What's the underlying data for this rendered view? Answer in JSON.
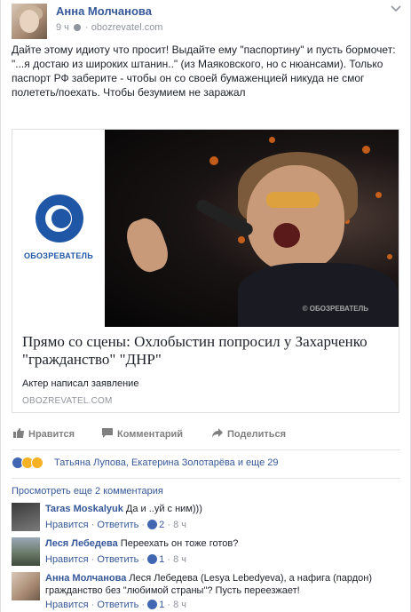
{
  "post": {
    "author": "Анна Молчанова",
    "time": "9 ч",
    "separator": "·",
    "source": "obozrevatel.com",
    "text": "Дайте этому идиоту что просит! Выдайте ему \"паспортину\" и пусть бормочет: \"...я достаю из широких штанин..\" (из Маяковского, но с нюансами). Только паспорт РФ заберите - чтобы он со своей бумаженцией никуда не смог полететь/поехать. Чтобы безумием не заражал"
  },
  "link": {
    "logo_text": "ОБОЗРЕВАТЕЛЬ",
    "watermark": "© ОБОЗРЕВАТЕЛЬ",
    "title": "Прямо со сцены: Охлобыстин попросил у Захарченко \"гражданство\" \"ДНР\"",
    "description": "Актер написал заявление",
    "domain": "OBOZREVATEL.COM"
  },
  "actions": {
    "like": "Нравится",
    "comment": "Комментарий",
    "share": "Поделиться"
  },
  "reactions": {
    "summary": "Татьяна Лупова, Екатерина Золотарёва и еще 29",
    "colors": {
      "like": "#4267b2",
      "haha": "#f7b125",
      "wow": "#f7b125"
    }
  },
  "comments_more": "Просмотреть еще 2 комментария",
  "comments": [
    {
      "name": "Taras Moskalyuk",
      "text": "Да и ..уй с ним)))",
      "like": "Нравится",
      "reply": "Ответить",
      "likes": "2",
      "time": "8 ч"
    },
    {
      "name": "Леся Лебедева",
      "text": "Переехать он тоже готов?",
      "like": "Нравится",
      "reply": "Ответить",
      "likes": "1",
      "time": "8 ч"
    },
    {
      "name": "Анна Молчанова",
      "text": "Леся Лебедева (Lesya Lebedyeva), а нафига (пардон) гражданство без \"любимой страны\"? Пусть переезжает!",
      "like": "Нравится",
      "reply": "Ответить",
      "likes": "1",
      "time": "8 ч"
    }
  ],
  "link_sep": "·",
  "icons": [
    "chevron-down-icon",
    "globe-icon",
    "like-icon",
    "comment-icon",
    "share-icon",
    "like-reaction-icon",
    "haha-reaction-icon",
    "wow-reaction-icon"
  ]
}
